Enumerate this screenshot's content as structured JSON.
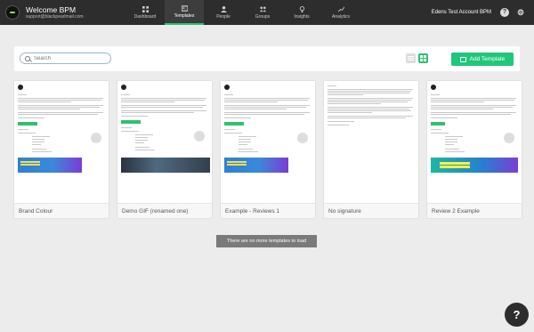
{
  "header": {
    "app_title": "Welcome BPM",
    "email": "support@blackpearlmail.com",
    "account_name": "Edens Test Account BPM",
    "help_glyph": "?",
    "settings_glyph": "⚙"
  },
  "nav": {
    "items": [
      {
        "label": "Dashboard",
        "icon": "dashboard-icon",
        "active": false
      },
      {
        "label": "Templates",
        "icon": "templates-icon",
        "active": true
      },
      {
        "label": "People",
        "icon": "person-icon",
        "active": false
      },
      {
        "label": "Groups",
        "icon": "groups-icon",
        "active": false
      },
      {
        "label": "Insights",
        "icon": "lightbulb-icon",
        "active": false
      },
      {
        "label": "Analytics",
        "icon": "chart-icon",
        "active": false
      }
    ]
  },
  "toolbar": {
    "search_placeholder": "Search",
    "add_template_label": "Add Template"
  },
  "templates": [
    {
      "name": "Brand Colour"
    },
    {
      "name": "Demo GIF (renamed one)"
    },
    {
      "name": "Example - Reviews 1"
    },
    {
      "name": "No signature"
    },
    {
      "name": "Review 2 Example"
    }
  ],
  "status": {
    "no_more_text": "There are no more templates to load"
  },
  "help_button": {
    "label": "?"
  },
  "colors": {
    "accent_green": "#20c77a",
    "topbar": "#2d2d2d"
  }
}
